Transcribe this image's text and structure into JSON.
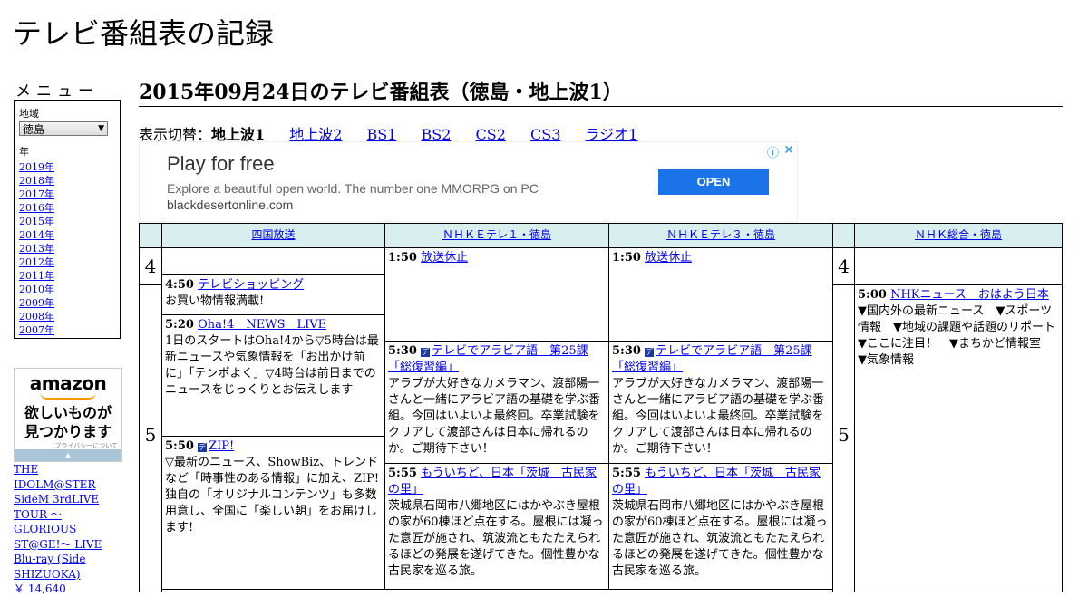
{
  "site": {
    "title": "テレビ番組表の記録"
  },
  "menu": {
    "title": "メニュー",
    "region_label": "地域",
    "region_value": "徳島",
    "year_label": "年",
    "years": [
      "2019年",
      "2018年",
      "2017年",
      "2016年",
      "2015年",
      "2014年",
      "2013年",
      "2012年",
      "2011年",
      "2010年",
      "2009年",
      "2008年",
      "2007年"
    ]
  },
  "amazon_ad": {
    "logo": "amazon",
    "tagline_1": "欲しいものが",
    "tagline_2": "見つかります",
    "privacy": "プライバシーについて"
  },
  "product": {
    "title": "THE IDOLM@STER SideM 3rdLIVE TOUR ～GLORIOUS ST@GE!～ LIVE Blu-ray (Side SHIZUOKA)",
    "price": "￥ 14,640"
  },
  "main": {
    "heading": "2015年09月24日のテレビ番組表（徳島・地上波1）",
    "switch_label": "表示切替：",
    "switch_current": "地上波1",
    "switch_links": [
      "地上波2",
      "BS1",
      "BS2",
      "CS2",
      "CS3",
      "ラジオ1"
    ]
  },
  "banner_ad": {
    "headline": "Play for free",
    "description": "Explore a beautiful open world. The number one MMORPG on PC",
    "domain": "blackdesertonline.com",
    "button": "OPEN",
    "close": "✕"
  },
  "schedule": {
    "channels": [
      "四国放送",
      "ＮＨＫＥテレ１・徳島",
      "ＮＨＫＥテレ３・徳島",
      "ＮＨＫ総合・徳島"
    ],
    "hours": [
      "4",
      "5",
      "4",
      "5"
    ],
    "programs": [
      {
        "time": "4:50",
        "title": "テレビショッピング",
        "desc": "お買い物情報満載!"
      },
      {
        "time": "5:20",
        "title": "Oha!4　NEWS　LIVE",
        "desc": "1日のスタートはOha!4から▽5時台は最新ニュースや気象情報を「お出かけ前に」「テンポよく」▽4時台は前日までのニュースをじっくりとお伝えします"
      },
      {
        "time": "5:50",
        "title": "ZIP!",
        "desc": "▽最新のニュース、ShowBiz、トレンドなど「時事性のある情報」に加え、ZIP!独自の「オリジナルコンテンツ」も多数用意し、全国に「楽しい朝」をお届けします!"
      },
      {
        "time": "1:50",
        "title": "放送休止",
        "desc": ""
      },
      {
        "time": "5:30",
        "title": "テレビでアラビア語　第25課「総復習編」",
        "desc": "アラブが大好きなカメラマン、渡部陽一さんと一緒にアラビア語の基礎を学ぶ番組。今回はいよいよ最終回。卒業試験をクリアして渡部さんは日本に帰れるのか。ご期待下さい！"
      },
      {
        "time": "5:55",
        "title": "もういちど、日本「茨城　古民家の里」",
        "desc": "茨城県石岡市八郷地区にはかやぶき屋根の家が60棟ほど点在する。屋根には凝った意匠が施され、筑波流ともたたえられるほどの発展を遂げてきた。個性豊かな古民家を巡る旅。"
      },
      {
        "time": "1:50",
        "title": "放送休止",
        "desc": ""
      },
      {
        "time": "5:30",
        "title": "テレビでアラビア語　第25課「総復習編」",
        "desc": "アラブが大好きなカメラマン、渡部陽一さんと一緒にアラビア語の基礎を学ぶ番組。今回はいよいよ最終回。卒業試験をクリアして渡部さんは日本に帰れるのか。ご期待下さい！"
      },
      {
        "time": "5:55",
        "title": "もういちど、日本「茨城　古民家の里」",
        "desc": "茨城県石岡市八郷地区にはかやぶき屋根の家が60棟ほど点在する。屋根には凝った意匠が施され、筑波流ともたたえられるほどの発展を遂げてきた。個性豊かな古民家を巡る旅。"
      },
      {
        "time": "5:00",
        "title": "NHKニュース　おはよう日本",
        "desc": "▼国内外の最新ニュース　▼スポーツ情報　▼地域の課題や話題のリポート　▼ここに注目！　▼まちかど情報室　▼気象情報"
      }
    ]
  }
}
